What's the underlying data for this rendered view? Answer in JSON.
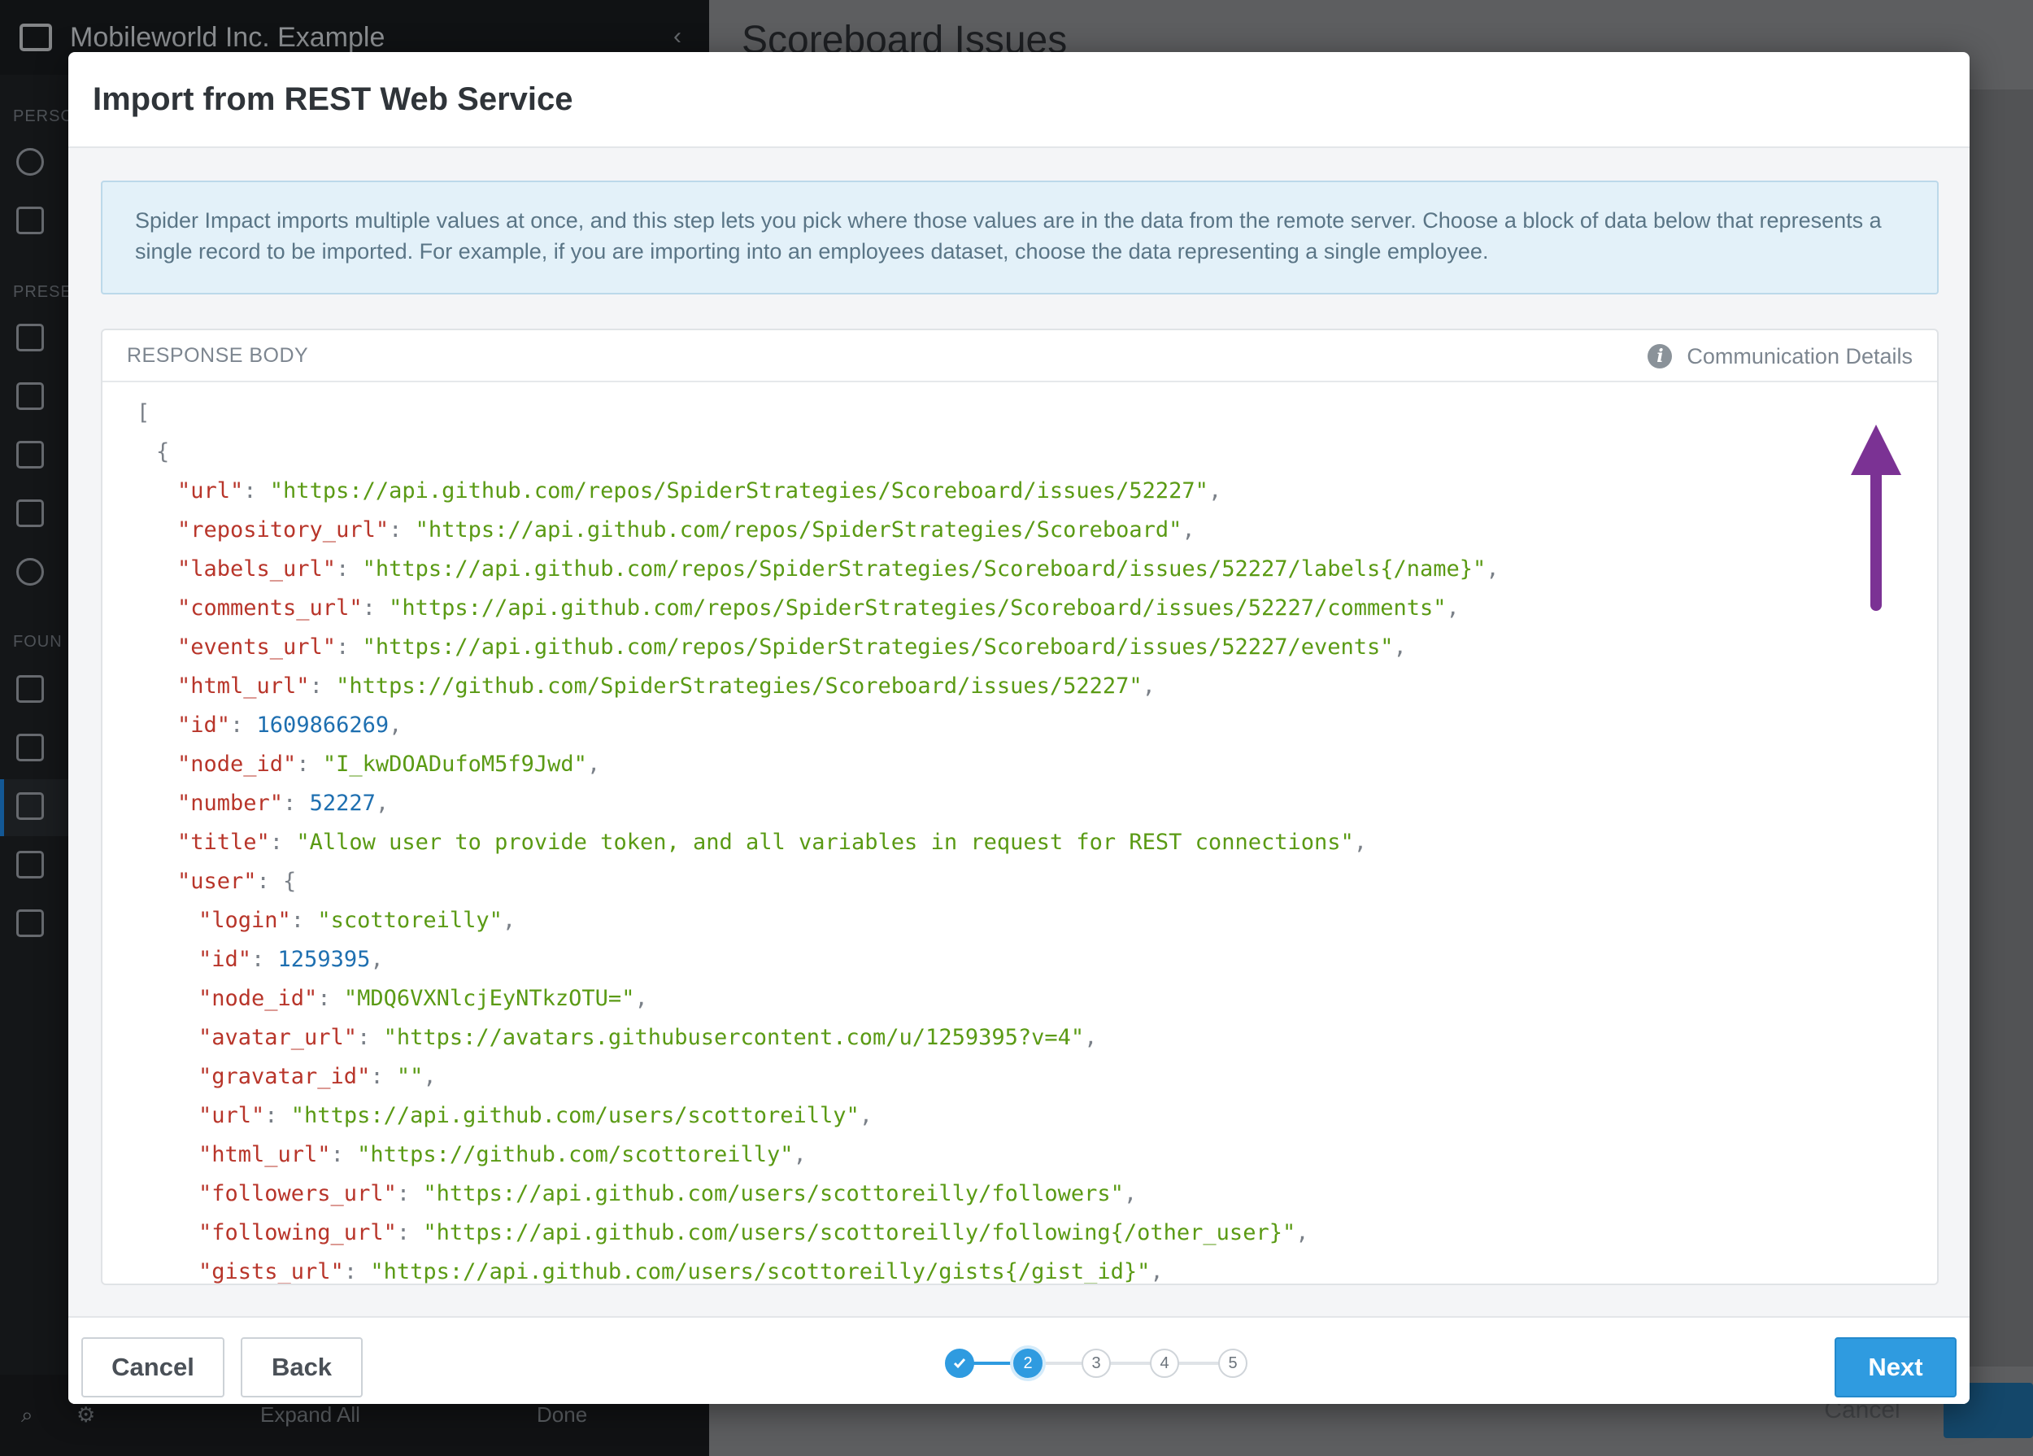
{
  "background": {
    "org_name": "Mobileworld Inc. Example",
    "page_title": "Scoreboard Issues",
    "footer_expand_all": "Expand All",
    "footer_done": "Done",
    "bg_cancel": "Cancel"
  },
  "modal": {
    "title": "Import from REST Web Service",
    "info_text": "Spider Impact imports multiple values at once, and this step lets you pick where those values are in the data from the remote server. Choose a block of data below that represents a single record to be imported. For example, if you are importing into an employees dataset, choose the data representing a single employee.",
    "response_label": "RESPONSE BODY",
    "communication_details": "Communication Details",
    "json_lines": {
      "l0": "[",
      "l1": "{",
      "url_k": "\"url\"",
      "url_v": "\"https://api.github.com/repos/SpiderStrategies/Scoreboard/issues/52227\"",
      "repo_k": "\"repository_url\"",
      "repo_v": "\"https://api.github.com/repos/SpiderStrategies/Scoreboard\"",
      "labels_k": "\"labels_url\"",
      "labels_v": "\"https://api.github.com/repos/SpiderStrategies/Scoreboard/issues/52227/labels{/name}\"",
      "comments_k": "\"comments_url\"",
      "comments_v": "\"https://api.github.com/repos/SpiderStrategies/Scoreboard/issues/52227/comments\"",
      "events_k": "\"events_url\"",
      "events_v": "\"https://api.github.com/repos/SpiderStrategies/Scoreboard/issues/52227/events\"",
      "html_k": "\"html_url\"",
      "html_v": "\"https://github.com/SpiderStrategies/Scoreboard/issues/52227\"",
      "id_k": "\"id\"",
      "id_v": "1609866269",
      "node_k": "\"node_id\"",
      "node_v": "\"I_kwDOADufoM5f9Jwd\"",
      "number_k": "\"number\"",
      "number_v": "52227",
      "title_k": "\"title\"",
      "title_v": "\"Allow user to provide token, and all variables in request for REST connections\"",
      "user_k": "\"user\"",
      "login_k": "\"login\"",
      "login_v": "\"scottoreilly\"",
      "uid_k": "\"id\"",
      "uid_v": "1259395",
      "unode_k": "\"node_id\"",
      "unode_v": "\"MDQ6VXNlcjEyNTkzOTU=\"",
      "avatar_k": "\"avatar_url\"",
      "avatar_v": "\"https://avatars.githubusercontent.com/u/1259395?v=4\"",
      "gravatar_k": "\"gravatar_id\"",
      "gravatar_v": "\"\"",
      "uurl_k": "\"url\"",
      "uurl_v": "\"https://api.github.com/users/scottoreilly\"",
      "uhtml_k": "\"html_url\"",
      "uhtml_v": "\"https://github.com/scottoreilly\"",
      "followers_k": "\"followers_url\"",
      "followers_v": "\"https://api.github.com/users/scottoreilly/followers\"",
      "following_k": "\"following_url\"",
      "following_v": "\"https://api.github.com/users/scottoreilly/following{/other_user}\"",
      "gists_k": "\"gists_url\"",
      "gists_v": "\"https://api.github.com/users/scottoreilly/gists{/gist_id}\""
    },
    "buttons": {
      "cancel": "Cancel",
      "back": "Back",
      "next": "Next"
    },
    "steps": [
      "1",
      "2",
      "3",
      "4",
      "5"
    ],
    "current_step": 2
  },
  "colors": {
    "accent": "#2f9be0",
    "json_key": "#b8352a",
    "json_string": "#5a9a14",
    "json_number": "#1e6fb0",
    "annotation_arrow": "#7b3294"
  }
}
